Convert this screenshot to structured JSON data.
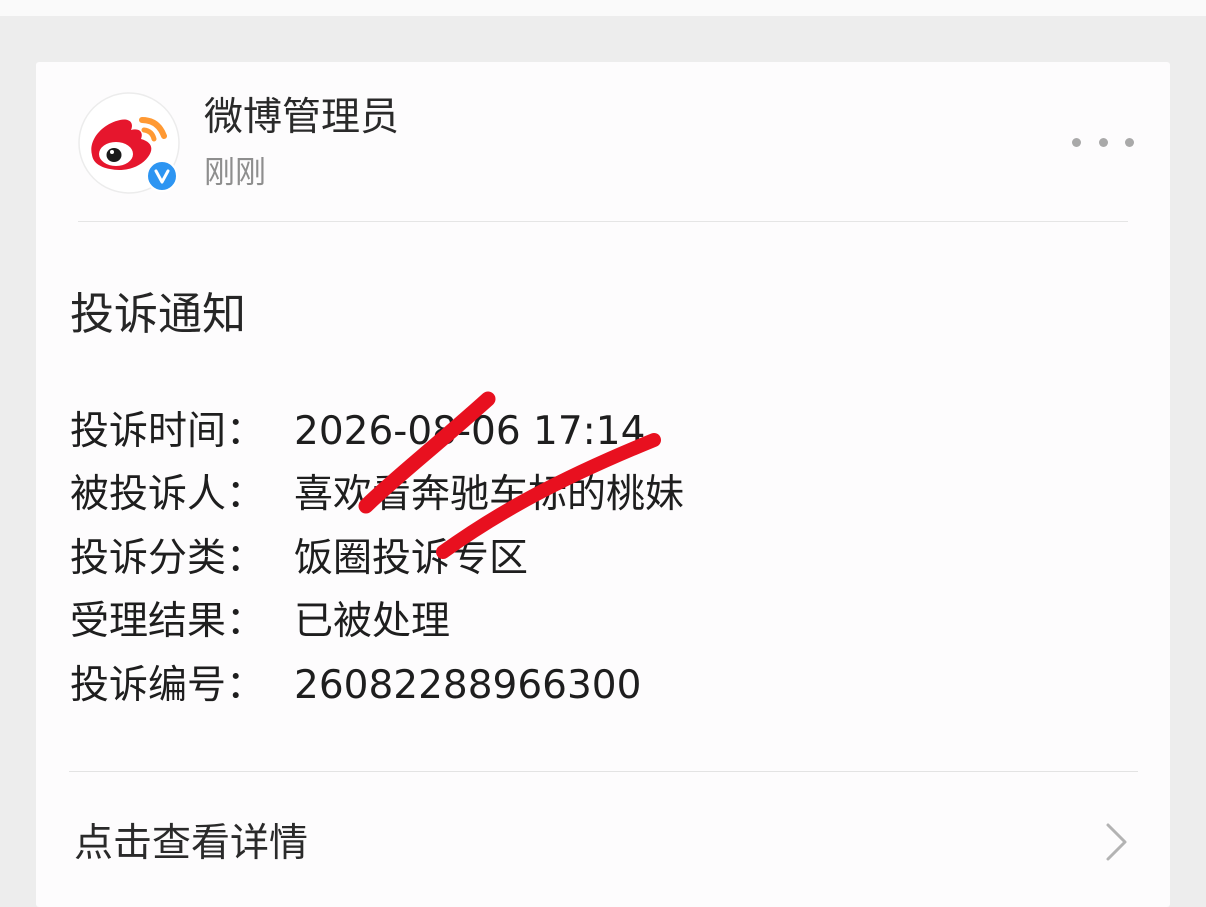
{
  "post": {
    "author": "微博管理员",
    "time": "刚刚",
    "verified_badge": "v"
  },
  "notice": {
    "title": "投诉通知",
    "rows": [
      {
        "label": "投诉时间：",
        "value": "2026-08-06 17:14"
      },
      {
        "label": "被投诉人：",
        "value": "喜欢看奔驰车标的桃妹"
      },
      {
        "label": "投诉分类：",
        "value": "饭圈投诉专区"
      },
      {
        "label": "受理结果：",
        "value": "已被处理"
      },
      {
        "label": "投诉编号：",
        "value": "26082288966300"
      }
    ]
  },
  "footer": {
    "details_label": "点击查看详情"
  },
  "icons": {
    "avatar": "weibo-logo-icon",
    "badge": "verified-badge-icon",
    "more": "more-dots-icon",
    "chevron": "chevron-right-icon"
  },
  "colors": {
    "weibo_red": "#e6162d",
    "weibo_orange": "#ff9933",
    "verified_blue": "#2d95f2",
    "scribble_red": "#e8101f"
  }
}
